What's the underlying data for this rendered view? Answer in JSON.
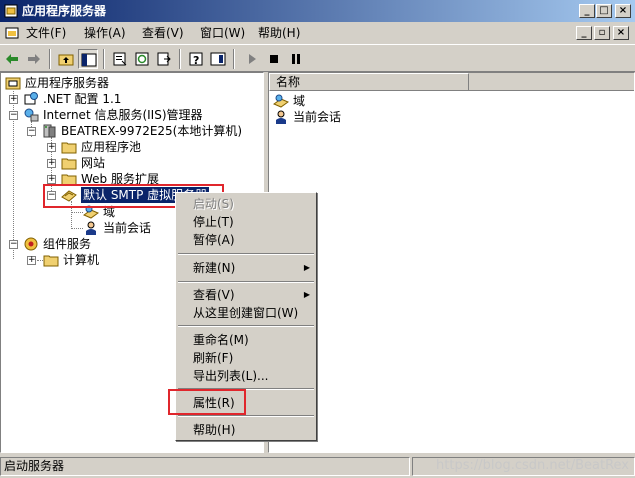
{
  "window": {
    "title": "应用程序服务器",
    "buttons": {
      "minimize": "_",
      "maximize": "□",
      "close": "×"
    }
  },
  "menubar": {
    "items": [
      "文件(F)",
      "操作(A)",
      "查看(V)",
      "窗口(W)",
      "帮助(H)"
    ],
    "mdi_buttons": {
      "minimize": "_",
      "restore": "▫",
      "close": "×"
    }
  },
  "toolbar": {
    "icons": [
      "back-icon",
      "forward-icon",
      "up-folder-icon",
      "show-tree-icon",
      "properties-icon",
      "refresh-icon",
      "export-icon",
      "help-icon",
      "show-hide-icon",
      "play-icon",
      "stop-icon",
      "pause-icon"
    ]
  },
  "tree": {
    "root": "应用程序服务器",
    "net_config": ".NET 配置 1.1",
    "iis_manager": "Internet 信息服务(IIS)管理器",
    "computer": "BEATREX-9972E25(本地计算机)",
    "app_pools": "应用程序池",
    "websites": "网站",
    "web_ext": "Web 服务扩展",
    "smtp": "默认 SMTP 虚拟服务器",
    "domains": "域",
    "sessions": "当前会话",
    "component_services": "组件服务",
    "computers": "计算机"
  },
  "list": {
    "column_name": "名称",
    "items": [
      "域",
      "当前会话"
    ]
  },
  "context_menu": {
    "start": "启动(S)",
    "stop": "停止(T)",
    "pause": "暂停(A)",
    "new": "新建(N)",
    "view": "查看(V)",
    "new_window": "从这里创建窗口(W)",
    "rename": "重命名(M)",
    "refresh": "刷新(F)",
    "export_list": "导出列表(L)...",
    "properties": "属性(R)",
    "help": "帮助(H)",
    "submenu_arrow": "▶"
  },
  "status": {
    "text": "启动服务器",
    "watermark": "https://blog.csdn.net/BeatRex"
  },
  "colors": {
    "title_gradient_start": "#0a246a",
    "title_gradient_end": "#a6caf0",
    "selection": "#0a246a",
    "highlight_box": "#e0262c",
    "face": "#d4d0c8"
  }
}
